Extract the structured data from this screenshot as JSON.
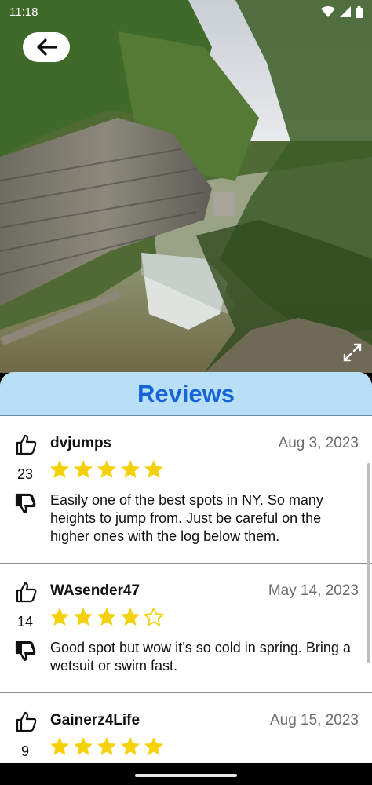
{
  "status": {
    "time": "11:18"
  },
  "hero": {
    "back_icon": "arrow-left-icon",
    "expand_icon": "expand-icon"
  },
  "reviews": {
    "title": "Reviews",
    "items": [
      {
        "user": "dvjumps",
        "date": "Aug 3, 2023",
        "votes": "23",
        "rating": 5,
        "text": "Easily one of the best spots in NY. So many heights to jump from. Just be careful on the higher ones with the log below them."
      },
      {
        "user": "WAsender47",
        "date": "May 14, 2023",
        "votes": "14",
        "rating": 4,
        "text": "Good spot but wow it’s so cold in spring. Bring a wetsuit or swim fast."
      },
      {
        "user": "Gainerz4Life",
        "date": "Aug 15, 2023",
        "votes": "9",
        "rating": 5,
        "text": ""
      }
    ]
  },
  "colors": {
    "title": "#1565d8",
    "header_bg": "#b9dff6",
    "star": "#f5d10a"
  }
}
